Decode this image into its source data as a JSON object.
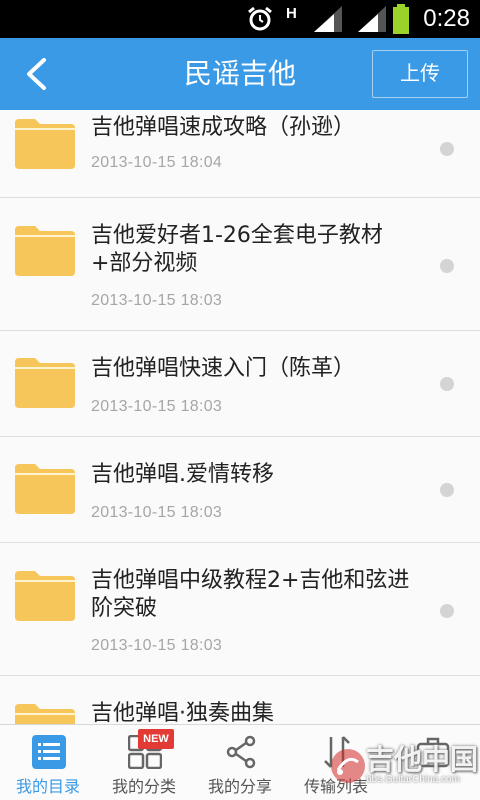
{
  "status_bar": {
    "time": "0:28",
    "network_type": "H",
    "icons": [
      "alarm-icon",
      "signal-icon",
      "signal-icon",
      "battery-icon"
    ]
  },
  "header": {
    "title": "民谣吉他",
    "back_icon": "chevron-left-icon",
    "upload_label": "上传",
    "background_color": "#3a9ae6"
  },
  "folders": [
    {
      "title": "吉他弹唱速成攻略（孙逊）",
      "date": "2013-10-15  18:04"
    },
    {
      "title": "吉他爱好者1-26全套电子教材+部分视频",
      "date": "2013-10-15  18:03"
    },
    {
      "title": "吉他弹唱快速入门（陈革）",
      "date": "2013-10-15  18:03"
    },
    {
      "title": "吉他弹唱.爱情转移",
      "date": "2013-10-15  18:03"
    },
    {
      "title": "吉他弹唱中级教程2+吉他和弦进阶突破",
      "date": "2013-10-15  18:03"
    },
    {
      "title": "吉他弹唱·独奏曲集",
      "date": ""
    }
  ],
  "bottom_nav": {
    "tabs": [
      {
        "label": "我的目录",
        "icon": "list-icon",
        "active": true
      },
      {
        "label": "我的分类",
        "icon": "category-grid-icon",
        "badge": "NEW"
      },
      {
        "label": "我的分享",
        "icon": "share-icon"
      },
      {
        "label": "传输列表",
        "icon": "transfer-icon"
      },
      {
        "label": "",
        "icon": "briefcase-icon"
      }
    ]
  },
  "watermark": {
    "text": "吉他中国",
    "subtext": "bbs.GuitarChina.com"
  },
  "colors": {
    "accent": "#3a9ae6",
    "folder": "#f7c65a",
    "badge": "#e23b36"
  }
}
